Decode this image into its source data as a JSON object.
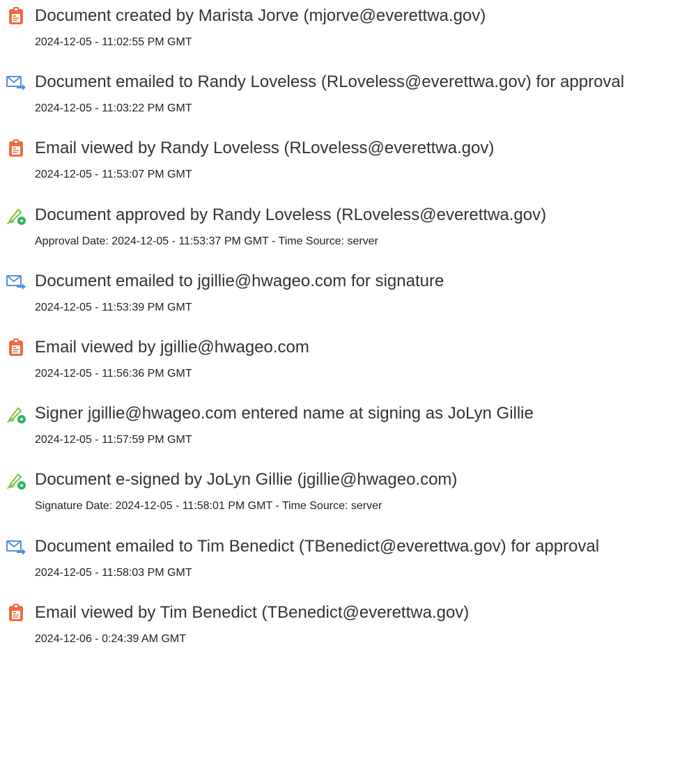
{
  "colors": {
    "doc_icon": "#F26A3D",
    "email_icon": "#5A8CDB",
    "email_arrow": "#4A90E2",
    "sign_pen": "#7CC242",
    "sign_badge": "#2FAF63",
    "text": "#333333"
  },
  "events": [
    {
      "icon": "document-icon",
      "title": "Document created by Marista Jorve (mjorve@everettwa.gov)",
      "date": "2024-12-05 - 11:02:55 PM GMT"
    },
    {
      "icon": "email-sent-icon",
      "title": "Document emailed to Randy Loveless (RLoveless@everettwa.gov) for approval",
      "date": "2024-12-05 - 11:03:22 PM GMT"
    },
    {
      "icon": "document-icon",
      "title": "Email viewed by Randy Loveless (RLoveless@everettwa.gov)",
      "date": "2024-12-05 - 11:53:07 PM GMT"
    },
    {
      "icon": "signature-pen-icon",
      "title": "Document approved by Randy Loveless (RLoveless@everettwa.gov)",
      "date": "Approval Date: 2024-12-05 - 11:53:37 PM GMT - Time Source: server"
    },
    {
      "icon": "email-sent-icon",
      "title": "Document emailed to jgillie@hwageo.com for signature",
      "date": "2024-12-05 - 11:53:39 PM GMT"
    },
    {
      "icon": "document-icon",
      "title": "Email viewed by jgillie@hwageo.com",
      "date": "2024-12-05 - 11:56:36 PM GMT"
    },
    {
      "icon": "signature-pen-icon",
      "title": "Signer jgillie@hwageo.com entered name at signing as JoLyn Gillie",
      "date": "2024-12-05 - 11:57:59 PM GMT"
    },
    {
      "icon": "signature-pen-icon",
      "title": "Document e-signed by JoLyn Gillie (jgillie@hwageo.com)",
      "date": "Signature Date: 2024-12-05 - 11:58:01 PM GMT - Time Source: server"
    },
    {
      "icon": "email-sent-icon",
      "title": "Document emailed to Tim Benedict (TBenedict@everettwa.gov) for approval",
      "date": "2024-12-05 - 11:58:03 PM GMT"
    },
    {
      "icon": "document-icon",
      "title": "Email viewed by Tim Benedict (TBenedict@everettwa.gov)",
      "date": "2024-12-06 - 0:24:39 AM GMT"
    }
  ]
}
